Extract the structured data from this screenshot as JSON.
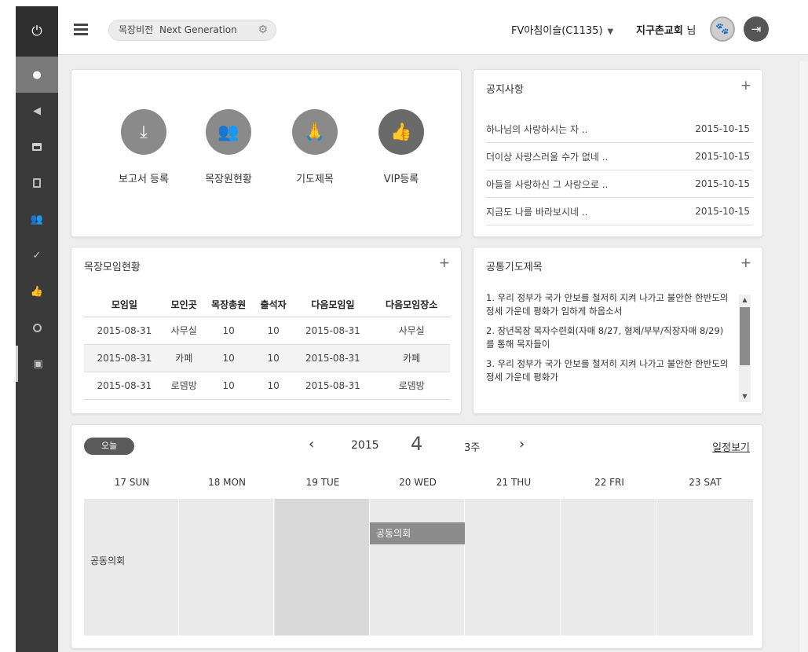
{
  "sidebar": {
    "items": [
      {
        "name": "power",
        "icon": "power-icon"
      },
      {
        "name": "home",
        "icon": "leaf-icon"
      },
      {
        "name": "notice",
        "icon": "megaphone-icon"
      },
      {
        "name": "calendar",
        "icon": "calendar-icon"
      },
      {
        "name": "document",
        "icon": "document-icon"
      },
      {
        "name": "members",
        "icon": "users-icon"
      },
      {
        "name": "check",
        "icon": "check-icon"
      },
      {
        "name": "like",
        "icon": "thumbs-up-icon"
      },
      {
        "name": "globe",
        "icon": "globe-icon"
      },
      {
        "name": "book",
        "icon": "book-icon"
      }
    ]
  },
  "header": {
    "vision_label": "목장비전",
    "vision_value": "Next Generation",
    "user_select": "FV아침이슬(C1135)",
    "user_name": "지구촌교회",
    "user_suffix": "님"
  },
  "quick_menu": {
    "items": [
      {
        "label": "보고서 등록",
        "icon": "download-tray-icon"
      },
      {
        "label": "목장원현황",
        "icon": "users-icon"
      },
      {
        "label": "기도제목",
        "icon": "praying-hands-icon"
      },
      {
        "label": "VIP등록",
        "icon": "thumbs-up-icon"
      }
    ]
  },
  "notice": {
    "title": "공지사항",
    "plus": "+",
    "rows": [
      {
        "title": "하나님의 사랑하시는 자 ..",
        "date": "2015-10-15"
      },
      {
        "title": "더이상 사랑스러울 수가 없네 ..",
        "date": "2015-10-15"
      },
      {
        "title": "아들을 사랑하신 그 사랑으로 ..",
        "date": "2015-10-15"
      },
      {
        "title": "지금도 나를 바라보시네 ..",
        "date": "2015-10-15"
      }
    ]
  },
  "meeting": {
    "title": "목장모임현황",
    "plus": "+",
    "columns": [
      "모임일",
      "모인곳",
      "목장총원",
      "출석자",
      "다음모임일",
      "다음모임장소"
    ],
    "rows": [
      [
        "2015-08-31",
        "사무실",
        "10",
        "10",
        "2015-08-31",
        "사무실"
      ],
      [
        "2015-08-31",
        "카페",
        "10",
        "10",
        "2015-08-31",
        "카페"
      ],
      [
        "2015-08-31",
        "로뎀방",
        "10",
        "10",
        "2015-08-31",
        "로뎀방"
      ]
    ]
  },
  "prayer": {
    "title": "공통기도제목",
    "plus": "+",
    "items": [
      "1. 우리 정부가 국가 안보를 철저히 지켜 나가고 불안한 한반도의 정세 가운데 평화가 임하게 하옵소서",
      "2. 장년목장 목자수련회(자매 8/27, 형제/부부/직장자매 8/29) 를 통해 목자들이",
      "3. 우리 정부가 국가 안보를 철저히 지켜 나가고 불안한 한반도의 정세 가운데 평화가"
    ]
  },
  "calendar": {
    "today_label": "오늘",
    "prev": "‹",
    "next": "›",
    "year": "2015",
    "month": "4",
    "week": "3주",
    "schedule_link": "일정보기",
    "days": [
      "17 SUN",
      "18 MON",
      "19 TUE",
      "20 WED",
      "21 THU",
      "22 FRI",
      "23 SAT"
    ],
    "events": [
      {
        "label": "공동의회",
        "day": "17 SUN"
      },
      {
        "label": "공동의회",
        "day": "20 WED"
      }
    ],
    "highlight_day": "19 TUE"
  }
}
